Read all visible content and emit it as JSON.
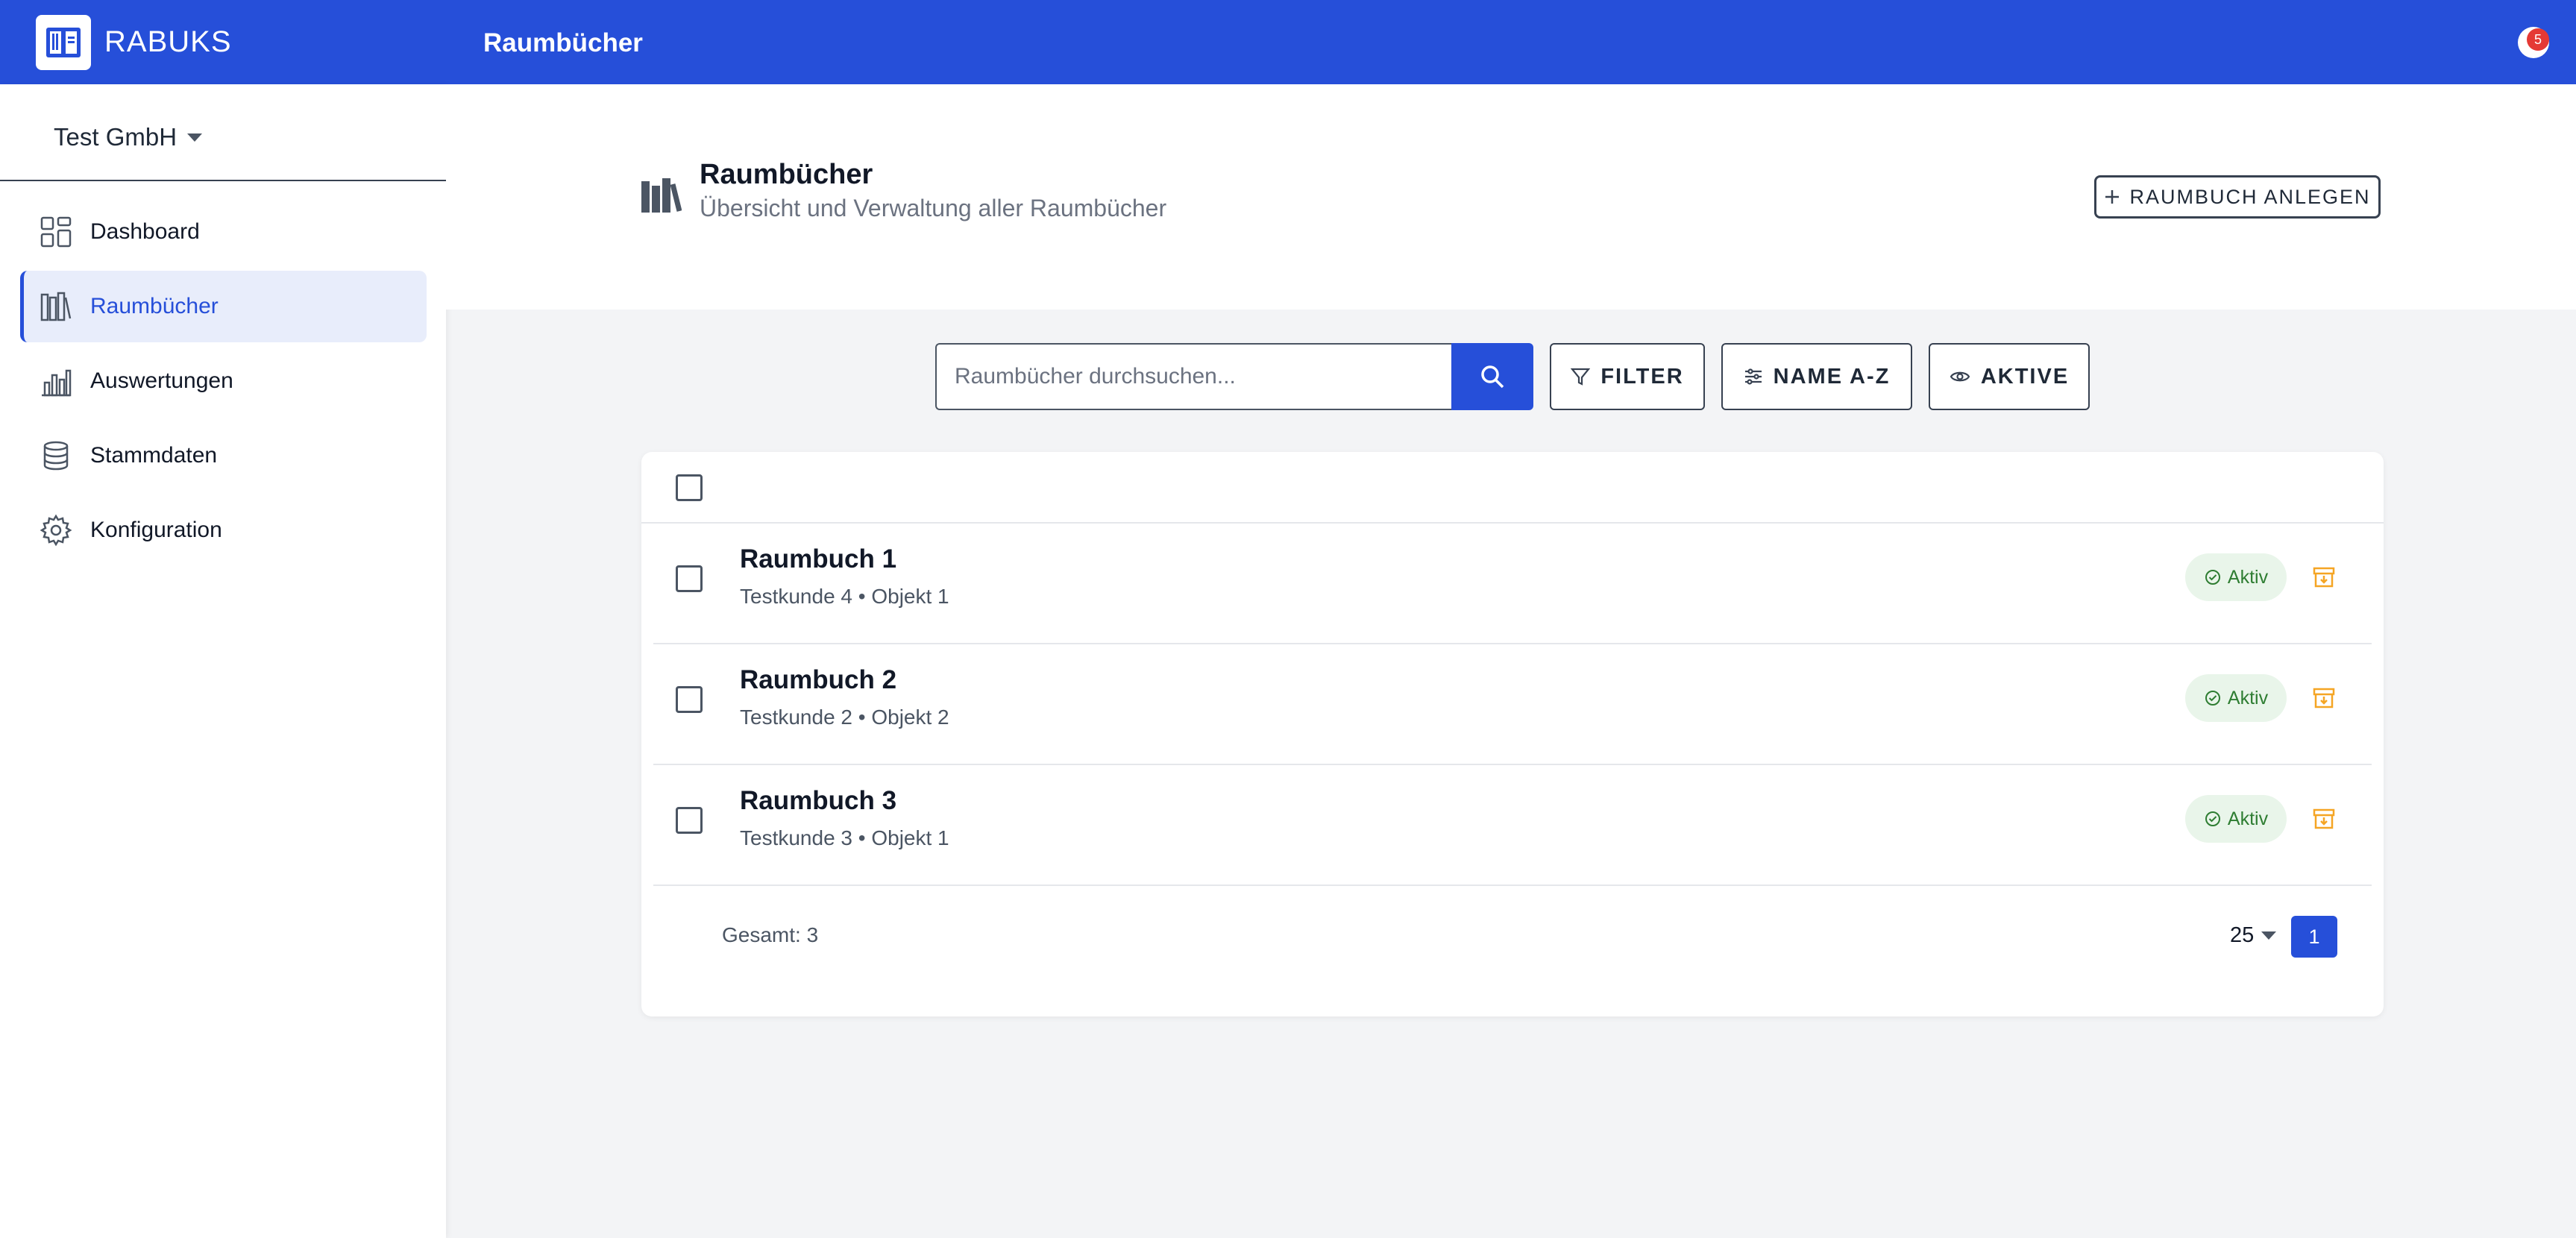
{
  "app": {
    "name": "RABUKS",
    "page_heading": "Raumbücher",
    "notification_count": "5"
  },
  "sidebar": {
    "company": "Test GmbH",
    "items": [
      {
        "label": "Dashboard",
        "icon": "dashboard-icon",
        "active": false
      },
      {
        "label": "Raumbücher",
        "icon": "books-icon",
        "active": true
      },
      {
        "label": "Auswertungen",
        "icon": "bar-chart-icon",
        "active": false
      },
      {
        "label": "Stammdaten",
        "icon": "database-icon",
        "active": false
      },
      {
        "label": "Konfiguration",
        "icon": "gear-icon",
        "active": false
      }
    ]
  },
  "header": {
    "title": "Raumbücher",
    "subtitle": "Übersicht und Verwaltung aller Raumbücher",
    "create_label": "RAUMBUCH ANLEGEN"
  },
  "toolbar": {
    "search_placeholder": "Raumbücher durchsuchen...",
    "filter_label": "FILTER",
    "sort_label": "NAME A-Z",
    "status_label": "AKTIVE"
  },
  "list": {
    "rows": [
      {
        "title": "Raumbuch 1",
        "subtitle": "Testkunde 4 • Objekt 1",
        "status": "Aktiv"
      },
      {
        "title": "Raumbuch 2",
        "subtitle": "Testkunde 2 • Objekt 2",
        "status": "Aktiv"
      },
      {
        "title": "Raumbuch 3",
        "subtitle": "Testkunde 3 • Objekt 1",
        "status": "Aktiv"
      }
    ],
    "total_label": "Gesamt: 3",
    "per_page": "25",
    "current_page": "1"
  },
  "colors": {
    "primary": "#264fd9",
    "active_bg": "#e8edfb",
    "status_bg": "#e9f5ea",
    "status_text": "#2e7d32",
    "archive": "#f5a524"
  }
}
